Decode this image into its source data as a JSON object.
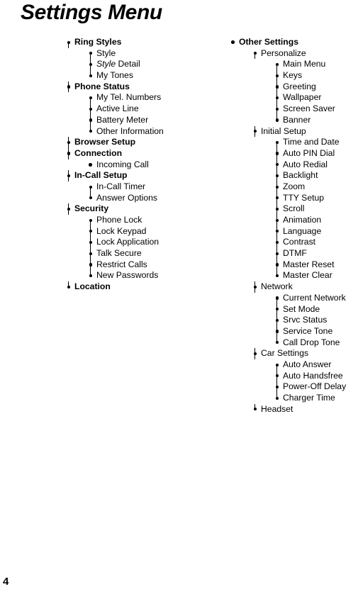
{
  "document": {
    "title": "Settings Menu",
    "page_number": "4"
  },
  "colors": {
    "text": "#000000",
    "background": "#ffffff",
    "connector_line": "#000000"
  },
  "columns": [
    {
      "id": "column-left",
      "items": [
        {
          "level": 1,
          "label": "Ring Styles",
          "bold": true,
          "bullet": "diamond",
          "line_up": false,
          "line_down": true
        },
        {
          "level": 2,
          "label": "Style",
          "bold": false,
          "bullet": "diamond",
          "line_up": false,
          "line_down": true
        },
        {
          "level": 2,
          "label": "Style Detail",
          "bold": false,
          "bullet": "diamond",
          "line_up": true,
          "line_down": true,
          "italic_prefix": "Style",
          "rest": " Detail"
        },
        {
          "level": 2,
          "label": "My Tones",
          "bold": false,
          "bullet": "diamond",
          "line_up": true,
          "line_down": false
        },
        {
          "level": 1,
          "label": "Phone Status",
          "bold": true,
          "bullet": "diamond",
          "line_up": true,
          "line_down": true
        },
        {
          "level": 2,
          "label": "My Tel. Numbers",
          "bold": false,
          "bullet": "diamond",
          "line_up": false,
          "line_down": true
        },
        {
          "level": 2,
          "label": "Active Line",
          "bold": false,
          "bullet": "diamond",
          "line_up": true,
          "line_down": true
        },
        {
          "level": 2,
          "label": "Battery Meter",
          "bold": false,
          "bullet": "diamond",
          "line_up": true,
          "line_down": true
        },
        {
          "level": 2,
          "label": "Other Information",
          "bold": false,
          "bullet": "diamond",
          "line_up": true,
          "line_down": false
        },
        {
          "level": 1,
          "label": "Browser Setup",
          "bold": true,
          "bullet": "diamond",
          "line_up": true,
          "line_down": true
        },
        {
          "level": 1,
          "label": "Connection",
          "bold": true,
          "bullet": "diamond",
          "line_up": true,
          "line_down": true
        },
        {
          "level": 2,
          "label": "Incoming Call",
          "bold": false,
          "bullet": "plain",
          "line_up": false,
          "line_down": false
        },
        {
          "level": 1,
          "label": "In-Call Setup",
          "bold": true,
          "bullet": "diamond",
          "line_up": true,
          "line_down": true
        },
        {
          "level": 2,
          "label": "In-Call Timer",
          "bold": false,
          "bullet": "diamond",
          "line_up": false,
          "line_down": true
        },
        {
          "level": 2,
          "label": "Answer Options",
          "bold": false,
          "bullet": "diamond",
          "line_up": true,
          "line_down": false
        },
        {
          "level": 1,
          "label": "Security",
          "bold": true,
          "bullet": "diamond",
          "line_up": true,
          "line_down": true
        },
        {
          "level": 2,
          "label": "Phone Lock",
          "bold": false,
          "bullet": "diamond",
          "line_up": false,
          "line_down": true
        },
        {
          "level": 2,
          "label": "Lock Keypad",
          "bold": false,
          "bullet": "diamond",
          "line_up": true,
          "line_down": true
        },
        {
          "level": 2,
          "label": "Lock Application",
          "bold": false,
          "bullet": "diamond",
          "line_up": true,
          "line_down": true
        },
        {
          "level": 2,
          "label": "Talk Secure",
          "bold": false,
          "bullet": "diamond",
          "line_up": true,
          "line_down": true
        },
        {
          "level": 2,
          "label": "Restrict Calls",
          "bold": false,
          "bullet": "diamond",
          "line_up": true,
          "line_down": true
        },
        {
          "level": 2,
          "label": "New Passwords",
          "bold": false,
          "bullet": "diamond",
          "line_up": true,
          "line_down": false
        },
        {
          "level": 1,
          "label": "Location",
          "bold": true,
          "bullet": "diamond",
          "line_up": true,
          "line_down": false
        }
      ]
    },
    {
      "id": "column-right",
      "items": [
        {
          "level": 1,
          "label": "Other Settings",
          "bold": true,
          "bullet": "plain",
          "line_up": false,
          "line_down": false
        },
        {
          "level": 2,
          "label": "Personalize",
          "bold": false,
          "bullet": "diamond",
          "line_up": false,
          "line_down": true
        },
        {
          "level": 3,
          "label": "Main Menu",
          "bold": false,
          "bullet": "diamond",
          "line_up": false,
          "line_down": true
        },
        {
          "level": 3,
          "label": "Keys",
          "bold": false,
          "bullet": "diamond",
          "line_up": true,
          "line_down": true
        },
        {
          "level": 3,
          "label": "Greeting",
          "bold": false,
          "bullet": "diamond",
          "line_up": true,
          "line_down": true
        },
        {
          "level": 3,
          "label": "Wallpaper",
          "bold": false,
          "bullet": "diamond",
          "line_up": true,
          "line_down": true
        },
        {
          "level": 3,
          "label": "Screen Saver",
          "bold": false,
          "bullet": "diamond",
          "line_up": true,
          "line_down": true
        },
        {
          "level": 3,
          "label": "Banner",
          "bold": false,
          "bullet": "diamond",
          "line_up": true,
          "line_down": false
        },
        {
          "level": 2,
          "label": "Initial Setup",
          "bold": false,
          "bullet": "diamond",
          "line_up": true,
          "line_down": true
        },
        {
          "level": 3,
          "label": "Time and Date",
          "bold": false,
          "bullet": "diamond",
          "line_up": false,
          "line_down": true
        },
        {
          "level": 3,
          "label": "Auto PIN Dial",
          "bold": false,
          "bullet": "diamond",
          "line_up": true,
          "line_down": true
        },
        {
          "level": 3,
          "label": "Auto Redial",
          "bold": false,
          "bullet": "diamond",
          "line_up": true,
          "line_down": true
        },
        {
          "level": 3,
          "label": "Backlight",
          "bold": false,
          "bullet": "diamond",
          "line_up": true,
          "line_down": true
        },
        {
          "level": 3,
          "label": "Zoom",
          "bold": false,
          "bullet": "diamond",
          "line_up": true,
          "line_down": true
        },
        {
          "level": 3,
          "label": "TTY Setup",
          "bold": false,
          "bullet": "diamond",
          "line_up": true,
          "line_down": true
        },
        {
          "level": 3,
          "label": "Scroll",
          "bold": false,
          "bullet": "diamond",
          "line_up": true,
          "line_down": true
        },
        {
          "level": 3,
          "label": "Animation",
          "bold": false,
          "bullet": "diamond",
          "line_up": true,
          "line_down": true
        },
        {
          "level": 3,
          "label": "Language",
          "bold": false,
          "bullet": "diamond",
          "line_up": true,
          "line_down": true
        },
        {
          "level": 3,
          "label": "Contrast",
          "bold": false,
          "bullet": "diamond",
          "line_up": true,
          "line_down": true
        },
        {
          "level": 3,
          "label": "DTMF",
          "bold": false,
          "bullet": "diamond",
          "line_up": true,
          "line_down": true
        },
        {
          "level": 3,
          "label": "Master Reset",
          "bold": false,
          "bullet": "diamond",
          "line_up": true,
          "line_down": true
        },
        {
          "level": 3,
          "label": "Master Clear",
          "bold": false,
          "bullet": "diamond",
          "line_up": true,
          "line_down": false
        },
        {
          "level": 2,
          "label": "Network",
          "bold": false,
          "bullet": "diamond",
          "line_up": true,
          "line_down": true
        },
        {
          "level": 3,
          "label": "Current Network",
          "bold": false,
          "bullet": "diamond",
          "line_up": false,
          "line_down": true
        },
        {
          "level": 3,
          "label": "Set Mode",
          "bold": false,
          "bullet": "diamond",
          "line_up": true,
          "line_down": true
        },
        {
          "level": 3,
          "label": "Srvc Status",
          "bold": false,
          "bullet": "diamond",
          "line_up": true,
          "line_down": true
        },
        {
          "level": 3,
          "label": "Service Tone",
          "bold": false,
          "bullet": "diamond",
          "line_up": true,
          "line_down": true
        },
        {
          "level": 3,
          "label": "Call Drop Tone",
          "bold": false,
          "bullet": "diamond",
          "line_up": true,
          "line_down": false
        },
        {
          "level": 2,
          "label": "Car Settings",
          "bold": false,
          "bullet": "diamond",
          "line_up": true,
          "line_down": true
        },
        {
          "level": 3,
          "label": "Auto Answer",
          "bold": false,
          "bullet": "diamond",
          "line_up": false,
          "line_down": true
        },
        {
          "level": 3,
          "label": "Auto Handsfree",
          "bold": false,
          "bullet": "diamond",
          "line_up": true,
          "line_down": true
        },
        {
          "level": 3,
          "label": "Power-Off Delay",
          "bold": false,
          "bullet": "diamond",
          "line_up": true,
          "line_down": true
        },
        {
          "level": 3,
          "label": "Charger Time",
          "bold": false,
          "bullet": "diamond",
          "line_up": true,
          "line_down": false
        },
        {
          "level": 2,
          "label": "Headset",
          "bold": false,
          "bullet": "diamond",
          "line_up": true,
          "line_down": false
        }
      ]
    }
  ]
}
